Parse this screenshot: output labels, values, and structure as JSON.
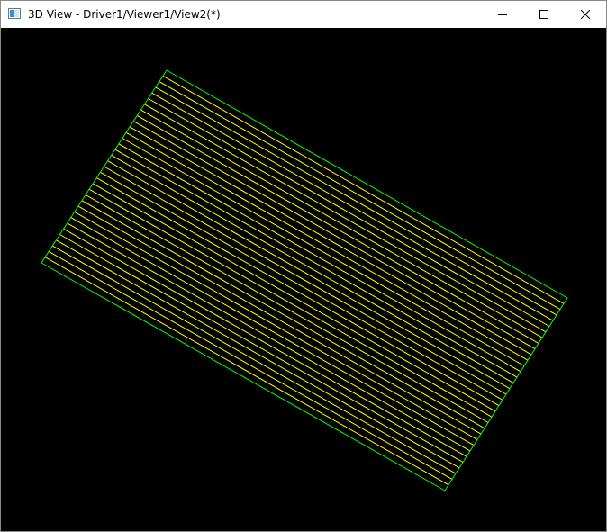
{
  "window": {
    "title": "3D View - Driver1/Viewer1/View2(*)",
    "icon": "viewer-window-icon",
    "controls": [
      "minimize-icon",
      "maximize-icon",
      "close-icon"
    ]
  },
  "viewport": {
    "background": "#000000",
    "outline_color": "#00ff00",
    "hatch_color": "#ffff00",
    "hatch_line_count": 33
  }
}
